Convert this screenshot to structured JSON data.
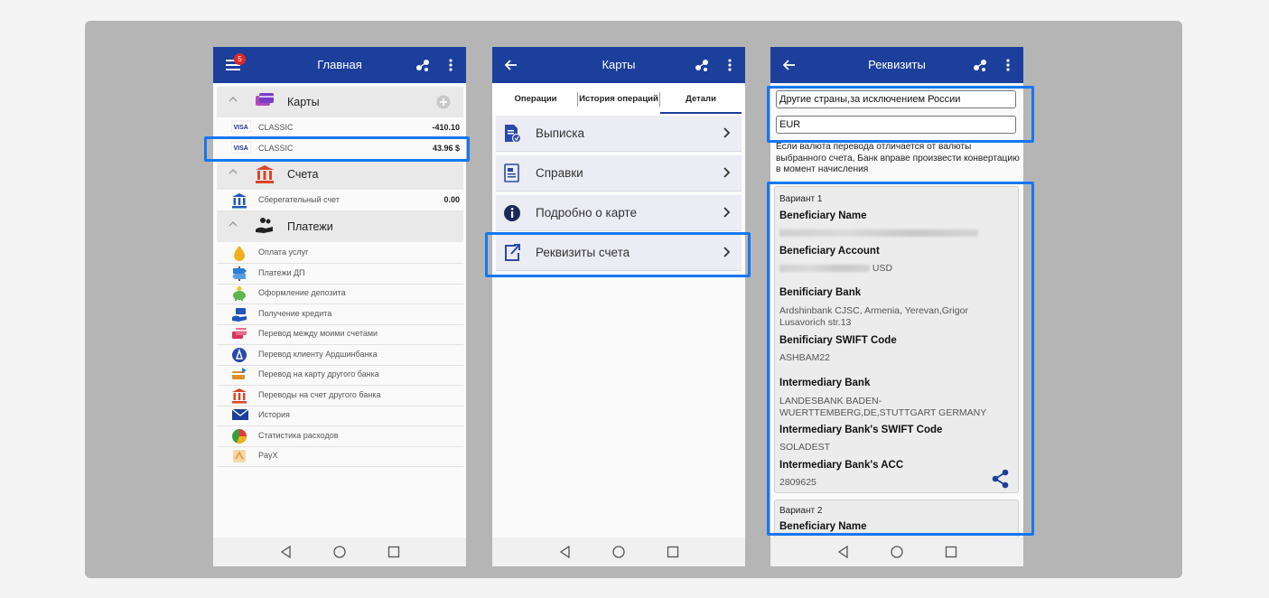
{
  "phone1": {
    "title": "Главная",
    "badge": "5",
    "groups": {
      "cards": {
        "label": "Карты"
      },
      "accounts": {
        "label": "Счета"
      },
      "payments": {
        "label": "Платежи"
      }
    },
    "cards": [
      {
        "name": "CLASSIC",
        "amount": "-410.10",
        "icon": "visa-icon"
      },
      {
        "name": "CLASSIC",
        "amount": "43.96 $",
        "icon": "visa-icon"
      }
    ],
    "accounts": [
      {
        "name": "Сберегательный счет",
        "amount": "0.00",
        "icon": "bank-icon"
      }
    ],
    "payments": [
      {
        "name": "Оплата услуг",
        "icon": "drop-icon",
        "color": "#f2b01e"
      },
      {
        "name": "Платежи ДП",
        "icon": "signpost-icon",
        "color": "#2c7fd6"
      },
      {
        "name": "Оформление депозита",
        "icon": "piggy-bank-icon",
        "color": "#5bb84a"
      },
      {
        "name": "Получение кредита",
        "icon": "hand-money-icon",
        "color": "#2255bb"
      },
      {
        "name": "Перевод между моими счетами",
        "icon": "cards-transfer-icon",
        "color": "#d8325a"
      },
      {
        "name": "Перевод клиенту Ардшинбанка",
        "icon": "ardshinbank-icon",
        "color": "#2a4aa8"
      },
      {
        "name": "Перевод на карту другого банка",
        "icon": "card-transfer-icon",
        "color": "#e0902a"
      },
      {
        "name": "Переводы на счет другого банка",
        "icon": "bank-icon",
        "color": "#d9452a"
      },
      {
        "name": "История",
        "icon": "envelope-icon",
        "color": "#1c3f9c"
      },
      {
        "name": "Статистика расходов",
        "icon": "pie-chart-icon",
        "color": "#3a9c3a"
      },
      {
        "name": "PayX",
        "icon": "payx-icon",
        "color": "#e8a24a"
      }
    ]
  },
  "phone2": {
    "title": "Карты",
    "tabs": [
      {
        "label": "Операции"
      },
      {
        "label": "История операций"
      },
      {
        "label": "Детали"
      }
    ],
    "menu": [
      {
        "label": "Выписка",
        "icon": "statement-icon"
      },
      {
        "label": "Справки",
        "icon": "certificate-icon"
      },
      {
        "label": "Подробно о карте",
        "icon": "info-icon"
      },
      {
        "label": "Реквизиты счета",
        "icon": "share-out-icon"
      }
    ]
  },
  "phone3": {
    "title": "Реквизиты",
    "country": "Другие страны,за исключением России",
    "currency": "EUR",
    "note": "Если валюта перевода отличается от валюты выбранного счета, Банк вправе произвести конвертацию в момент начисления",
    "variant1": {
      "label": "Вариант 1",
      "beneficiary_name_label": "Beneficiary Name",
      "beneficiary_account_label": "Beneficiary Account",
      "beneficiary_account_suffix": "USD",
      "bank_label": "Benificiary Bank",
      "bank_value": "Ardshinbank CJSC, Armenia, Yerevan,Grigor Lusavorich str.13",
      "swift_label": "Benificiary SWIFT Code",
      "swift_value": "ASHBAM22",
      "intermediary_label": "Intermediary Bank",
      "intermediary_value": "LANDESBANK BADEN-WUERTTEMBERG,DE,STUTTGART GERMANY",
      "intermediary_swift_label": "Intermediary Bank's SWIFT Code",
      "intermediary_swift_value": "SOLADEST",
      "intermediary_acc_label": "Intermediary Bank's ACC",
      "intermediary_acc_value": "2809625"
    },
    "variant2": {
      "label": "Вариант 2",
      "beneficiary_name_label": "Beneficiary Name"
    }
  },
  "colors": {
    "appbar": "#1c3f9c",
    "highlight": "#1677f0",
    "panel": "#b5b5b5"
  }
}
